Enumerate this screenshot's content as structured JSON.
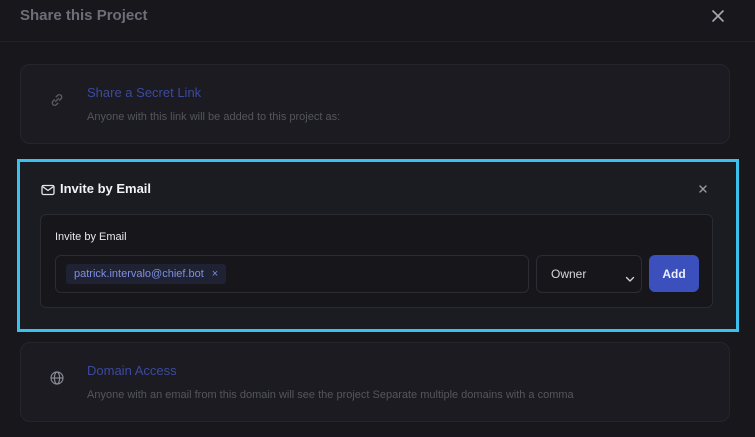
{
  "modal": {
    "title": "Share this Project",
    "close_icon": "close-icon"
  },
  "share_link": {
    "icon": "link-icon",
    "title": "Share a Secret Link",
    "description": "Anyone with this link will be added to this project as:"
  },
  "invite": {
    "icon": "mail-icon",
    "title": "Invite by Email",
    "close_icon": "close-icon",
    "field_label": "Invite by Email",
    "emails": [
      {
        "address": "patrick.intervalo@chief.bot",
        "remove_label": "×"
      }
    ],
    "role_value": "Owner",
    "role_icon": "chevron-down-icon",
    "add_label": "Add"
  },
  "domain": {
    "icon": "globe-icon",
    "title": "Domain Access",
    "description": "Anyone with an email from this domain will see the project Separate multiple domains with a comma"
  },
  "colors": {
    "highlight_border": "#3cc1ee",
    "accent": "#3b4fbd",
    "link_title": "#3b4a9e",
    "background": "#17171c"
  }
}
